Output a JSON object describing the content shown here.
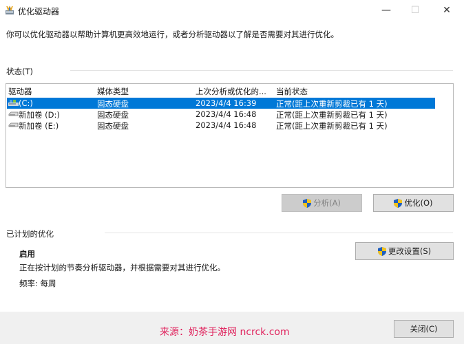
{
  "window": {
    "title": "优化驱动器",
    "min_glyph": "—",
    "max_glyph": "☐",
    "close_glyph": "✕"
  },
  "description": "你可以优化驱动器以帮助计算机更高效地运行，或者分析驱动器以了解是否需要对其进行优化。",
  "status": {
    "label": "状态(T)",
    "columns": [
      "驱动器",
      "媒体类型",
      "上次分析或优化的...",
      "当前状态"
    ],
    "rows": [
      {
        "drive": "(C:)",
        "media": "固态硬盘",
        "last": "2023/4/4 16:39",
        "state": "正常(距上次重新剪裁已有 1 天)",
        "selected": true,
        "icon": "system-drive-icon"
      },
      {
        "drive": "新加卷 (D:)",
        "media": "固态硬盘",
        "last": "2023/4/4 16:48",
        "state": "正常(距上次重新剪裁已有 1 天)",
        "selected": false,
        "icon": "drive-icon"
      },
      {
        "drive": "新加卷 (E:)",
        "media": "固态硬盘",
        "last": "2023/4/4 16:48",
        "state": "正常(距上次重新剪裁已有 1 天)",
        "selected": false,
        "icon": "drive-icon"
      }
    ]
  },
  "buttons": {
    "analyze": "分析(A)",
    "optimize": "优化(O)",
    "change_settings": "更改设置(S)",
    "close": "关闭(C)"
  },
  "scheduled": {
    "label": "已计划的优化",
    "state": "启用",
    "description": "正在按计划的节奏分析驱动器，并根据需要对其进行优化。",
    "frequency": "频率: 每周"
  },
  "watermark": "来源：奶茶手游网 ncrck.com",
  "colors": {
    "selection": "#0078d7",
    "watermark": "#e0245e",
    "footer": "#f0f0f0"
  }
}
